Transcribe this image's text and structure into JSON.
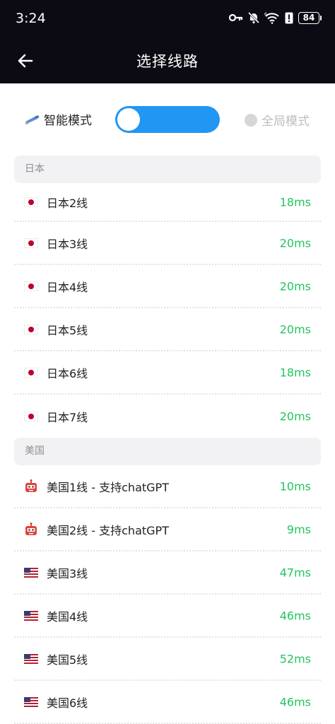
{
  "status_bar": {
    "time": "3:24",
    "battery": "84"
  },
  "app_bar": {
    "title": "选择线路",
    "back_icon": "arrow-left-icon"
  },
  "mode": {
    "smart_label": "智能模式",
    "global_label": "全局模式",
    "smart_enabled": true
  },
  "colors": {
    "accent": "#2196f3",
    "ping": "#22c55e",
    "header_bg": "#0c0a12"
  },
  "sections": [
    {
      "title": "日本",
      "lines": [
        {
          "flag": "japan-flag-icon",
          "name": "日本2线",
          "ping": "18ms"
        },
        {
          "flag": "japan-flag-icon",
          "name": "日本3线",
          "ping": "20ms"
        },
        {
          "flag": "japan-flag-icon",
          "name": "日本4线",
          "ping": "20ms"
        },
        {
          "flag": "japan-flag-icon",
          "name": "日本5线",
          "ping": "20ms"
        },
        {
          "flag": "japan-flag-icon",
          "name": "日本6线",
          "ping": "18ms"
        },
        {
          "flag": "japan-flag-icon",
          "name": "日本7线",
          "ping": "20ms"
        }
      ]
    },
    {
      "title": "美国",
      "lines": [
        {
          "flag": "robot-icon",
          "name": "美国1线 - 支持chatGPT",
          "ping": "10ms"
        },
        {
          "flag": "robot-icon",
          "name": "美国2线 - 支持chatGPT",
          "ping": "9ms"
        },
        {
          "flag": "usa-flag-icon",
          "name": "美国3线",
          "ping": "47ms"
        },
        {
          "flag": "usa-flag-icon",
          "name": "美国4线",
          "ping": "46ms"
        },
        {
          "flag": "usa-flag-icon",
          "name": "美国5线",
          "ping": "52ms"
        },
        {
          "flag": "usa-flag-icon",
          "name": "美国6线",
          "ping": "46ms"
        }
      ]
    }
  ]
}
